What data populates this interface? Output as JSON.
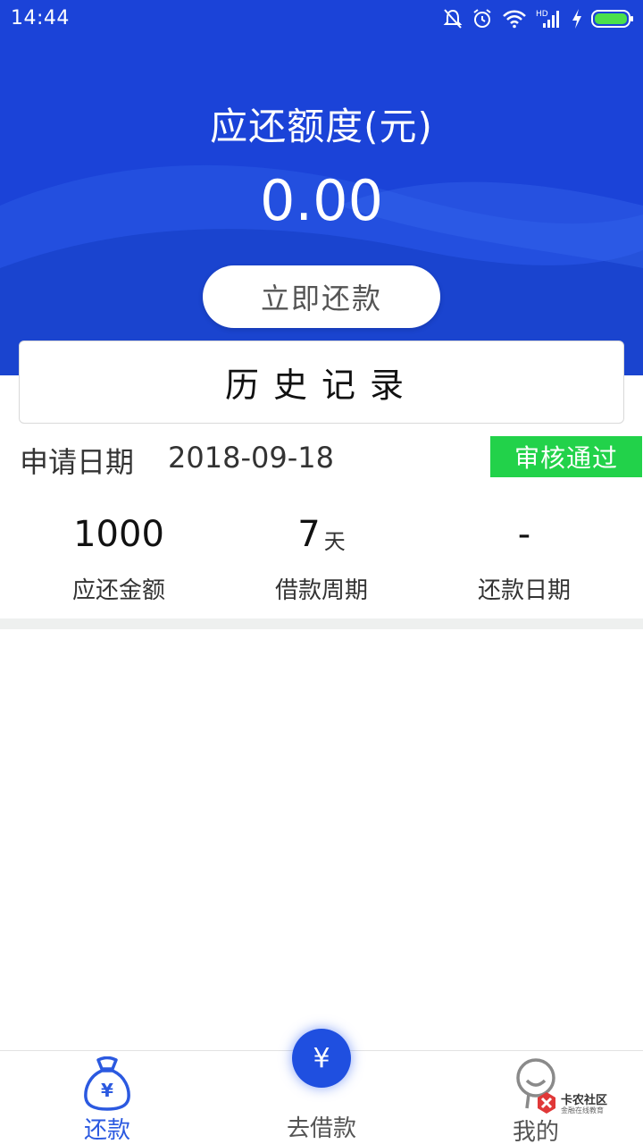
{
  "status_bar": {
    "time": "14:44",
    "network": "HD"
  },
  "header": {
    "title": "应还额度(元)",
    "amount": "0.00",
    "repay_button": "立即还款"
  },
  "history": {
    "label": "历史记录"
  },
  "record": {
    "apply_label": "申请日期",
    "apply_date": "2018-09-18",
    "status": "审核通过",
    "stats": [
      {
        "value": "1000",
        "unit": "",
        "label": "应还金额"
      },
      {
        "value": "7",
        "unit": "天",
        "label": "借款周期"
      },
      {
        "value": "-",
        "unit": "",
        "label": "还款日期"
      }
    ]
  },
  "tabbar": {
    "tabs": [
      {
        "label": "还款",
        "active": true
      },
      {
        "label": "去借款",
        "active": false
      },
      {
        "label": "我的",
        "active": false
      }
    ],
    "borrow_symbol": "¥"
  },
  "watermark": {
    "title": "卡农社区",
    "subtitle": "金融在线教育"
  },
  "colors": {
    "header_blue": "#1b43d8",
    "status_green": "#22d24a",
    "active_tab": "#2b59e0"
  }
}
